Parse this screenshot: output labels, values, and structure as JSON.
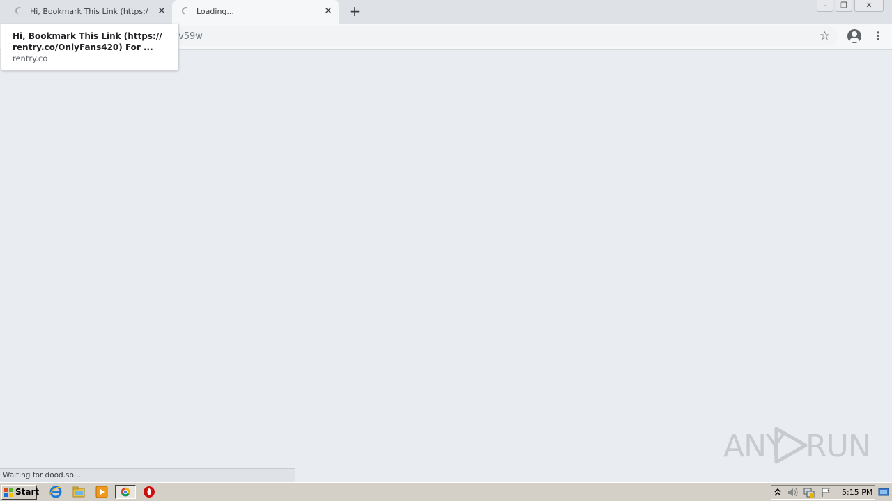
{
  "browser": {
    "tabs": [
      {
        "title": "Hi, Bookmark This Link (https://rentry.co/OnlyFans420) For ...",
        "state": "loading",
        "active": false
      },
      {
        "title": "Loading...",
        "state": "loading",
        "active": true
      }
    ],
    "new_tab_symbol": "+",
    "window_controls": {
      "minimize": "–",
      "restore": "❐",
      "close": "✕"
    },
    "address_bar": {
      "visible_url_fragment": "v59w"
    },
    "bookmark_icon": "star-outline-icon",
    "profile_icon": "account-circle-icon",
    "menu_icon": "three-dot-menu-icon"
  },
  "hover_card": {
    "title": "Hi, Bookmark This Link (https:// rentry.co/OnlyFans420) For ...",
    "domain": "rentry.co"
  },
  "status_bar": {
    "text": "Waiting for dood.so..."
  },
  "watermark": {
    "left": "ANY",
    "right": "RUN"
  },
  "taskbar": {
    "start_label": "Start",
    "quick_launch": [
      "internet-explorer-icon",
      "explorer-folder-icon",
      "media-player-icon",
      "chrome-icon",
      "opera-icon"
    ],
    "tray_icons": [
      "tray-expand-icon",
      "volume-icon",
      "network-icon",
      "action-center-flag-icon"
    ],
    "clock": "5:15 PM"
  },
  "colors": {
    "page_bg": "#e9ecf0",
    "tabstrip_bg": "#dee1e6",
    "toolbar_bg": "#f6f7f8",
    "taskbar_bg": "#d4d0c8",
    "opera_red": "#cc1010"
  }
}
